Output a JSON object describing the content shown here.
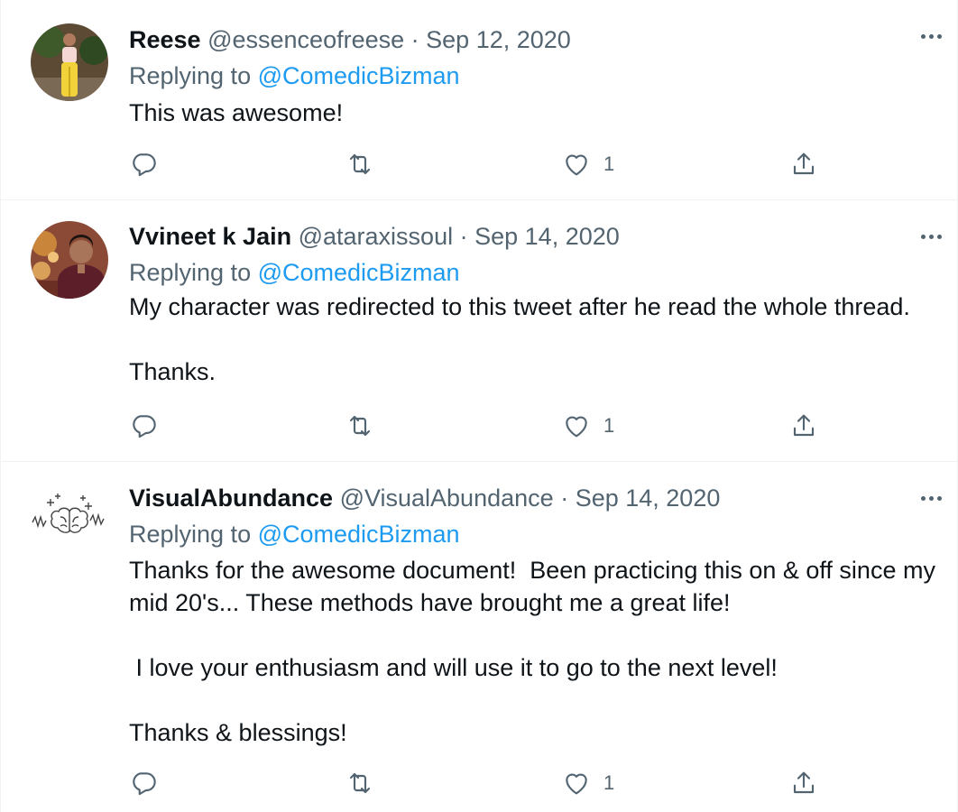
{
  "tweets": [
    {
      "display_name": "Reese",
      "handle": "@essenceofreese",
      "separator": "·",
      "date": "Sep 12, 2020",
      "replying_prefix": "Replying to ",
      "replying_to": "@ComedicBizman",
      "paragraphs": [
        "This was awesome!"
      ],
      "likes": "1",
      "avatar_colors": {
        "bg": "#6f5a3e",
        "figure": "#f1d23a",
        "top": "#f4d7d2",
        "skin": "#b07a5e"
      }
    },
    {
      "display_name": "Vvineet k Jain",
      "handle": "@ataraxissoul",
      "separator": "·",
      "date": "Sep 14, 2020",
      "replying_prefix": "Replying to ",
      "replying_to": "@ComedicBizman",
      "paragraphs": [
        "My character was redirected to this tweet after he read the whole thread.",
        "Thanks."
      ],
      "likes": "1",
      "avatar_colors": {
        "bg": "#7a3b2e",
        "jacket": "#5c1f2a",
        "skin": "#a8745a",
        "hair": "#1c1410"
      }
    },
    {
      "display_name": "VisualAbundance",
      "handle": "@VisualAbundance",
      "separator": "·",
      "date": "Sep 14, 2020",
      "replying_prefix": "Replying to ",
      "replying_to": "@ComedicBizman",
      "paragraphs": [
        "Thanks for the awesome document!  Been practicing this on & off since my mid 20's... These methods have brought me a great life!",
        " I love your enthusiasm and will use it to go to the next level!",
        "Thanks & blessings!"
      ],
      "likes": "1",
      "avatar_colors": {
        "bg": "#ffffff",
        "stroke": "#444444"
      }
    }
  ],
  "icons": {
    "reply": "reply-icon",
    "retweet": "retweet-icon",
    "like": "heart-icon",
    "share": "share-icon",
    "more": "more-icon"
  },
  "colors": {
    "text": "#0f1419",
    "secondary": "#536471",
    "accent": "#1d9bf0",
    "divider": "#eff3f4"
  }
}
